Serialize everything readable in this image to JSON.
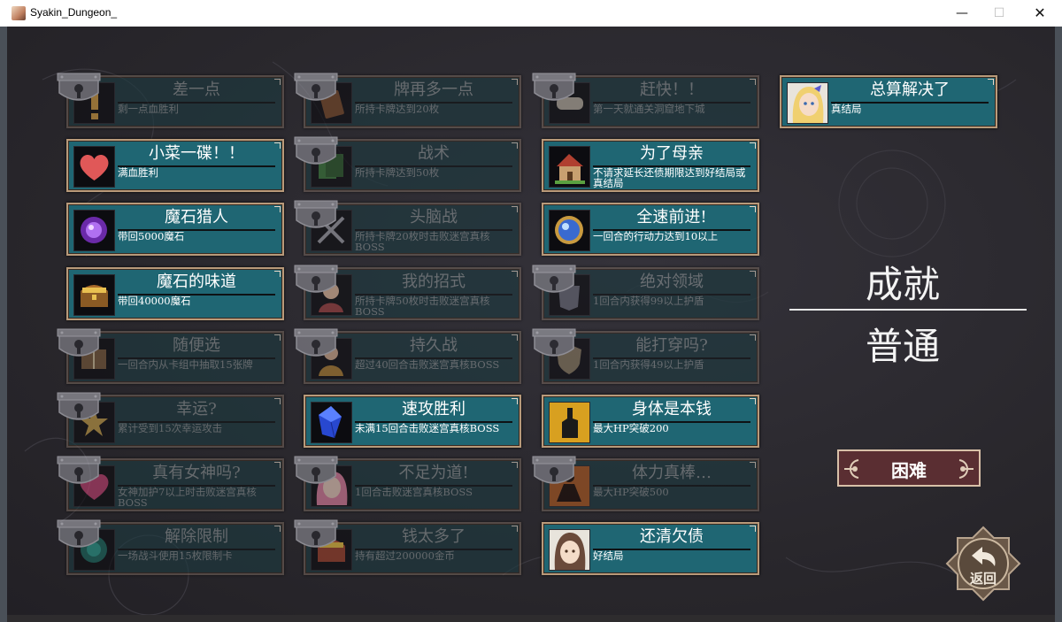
{
  "window": {
    "title": "Syakin_Dungeon_",
    "min_glyph": "—",
    "max_glyph": "☐",
    "close_glyph": "✕"
  },
  "achievements": [
    {
      "title": "差一点",
      "desc": "剩一点血胜利",
      "locked": true,
      "icon": "exclamation-icon"
    },
    {
      "title": "牌再多一点",
      "desc": "所持卡牌达到20枚",
      "locked": true,
      "icon": "card-icon"
    },
    {
      "title": "赶快！！",
      "desc": "第一天就通关洞窟地下城",
      "locked": true,
      "icon": "scroll-icon"
    },
    {
      "title": "总算解决了",
      "desc": "真结局",
      "locked": false,
      "icon": "blonde-heroine-icon"
    },
    {
      "title": "小菜一碟！！",
      "desc": "满血胜利",
      "locked": false,
      "icon": "heart-icon"
    },
    {
      "title": "战术",
      "desc": "所持卡牌达到50枚",
      "locked": true,
      "icon": "cards-icon"
    },
    {
      "title": "为了母亲",
      "desc": "不请求延长还债期限达到好结局或真结局",
      "locked": false,
      "icon": "house-icon"
    },
    {
      "title": "魔石猎人",
      "desc": "带回5000魔石",
      "locked": false,
      "icon": "purple-gem-icon"
    },
    {
      "title": "头脑战",
      "desc": "所持卡牌20枚时击败迷宫真核BOSS",
      "locked": true,
      "icon": "crossed-swords-icon"
    },
    {
      "title": "全速前进!",
      "desc": "一回合的行动力达到10以上",
      "locked": false,
      "icon": "orb-icon"
    },
    {
      "title": "魔石的味道",
      "desc": "带回40000魔石",
      "locked": false,
      "icon": "treasure-chest-icon"
    },
    {
      "title": "我的招式",
      "desc": "所持卡牌50枚时击败迷宫真核BOSS",
      "locked": true,
      "icon": "character-icon"
    },
    {
      "title": "绝对领域",
      "desc": "1回合内获得99以上护盾",
      "locked": true,
      "icon": "armor-icon"
    },
    {
      "title": "随便选",
      "desc": "一回合内从卡组中抽取15张牌",
      "locked": true,
      "icon": "book-icon"
    },
    {
      "title": "持久战",
      "desc": "超过40回合击败迷宫真核BOSS",
      "locked": true,
      "icon": "warrior-icon"
    },
    {
      "title": "能打穿吗?",
      "desc": "1回合内获得49以上护盾",
      "locked": true,
      "icon": "shield-icon"
    },
    {
      "title": "幸运?",
      "desc": "累计受到15次幸运攻击",
      "locked": true,
      "icon": "star-icon"
    },
    {
      "title": "速攻胜利",
      "desc": "未满15回合击败迷宫真核BOSS",
      "locked": false,
      "icon": "blue-crystal-icon"
    },
    {
      "title": "身体是本钱",
      "desc": "最大HP突破200",
      "locked": false,
      "icon": "fist-icon"
    },
    {
      "title": "真有女神吗?",
      "desc": "女神加护7以上时击败迷宫真核BOSS",
      "locked": true,
      "icon": "heart-gem-icon"
    },
    {
      "title": "不足为道!",
      "desc": "1回合击败迷宫真核BOSS",
      "locked": true,
      "icon": "pink-hair-icon"
    },
    {
      "title": "体力真棒…",
      "desc": "最大HP突破500",
      "locked": true,
      "icon": "silhouette-icon"
    },
    {
      "title": "解除限制",
      "desc": "一场战斗使用15枚限制卡",
      "locked": true,
      "icon": "emblem-icon"
    },
    {
      "title": "钱太多了",
      "desc": "持有超过200000金币",
      "locked": true,
      "icon": "gold-chest-icon"
    },
    {
      "title": "还清欠债",
      "desc": "好结局",
      "locked": false,
      "icon": "brunette-heroine-icon"
    }
  ],
  "panel": {
    "title": "成就",
    "current_difficulty": "普通"
  },
  "buttons": {
    "hard": "困难",
    "back": "返回"
  },
  "colors": {
    "card_unlocked": "#1f6673",
    "card_locked": "#1d3a40",
    "hard_button": "#5a2e32",
    "frame": "#b89a7a"
  }
}
